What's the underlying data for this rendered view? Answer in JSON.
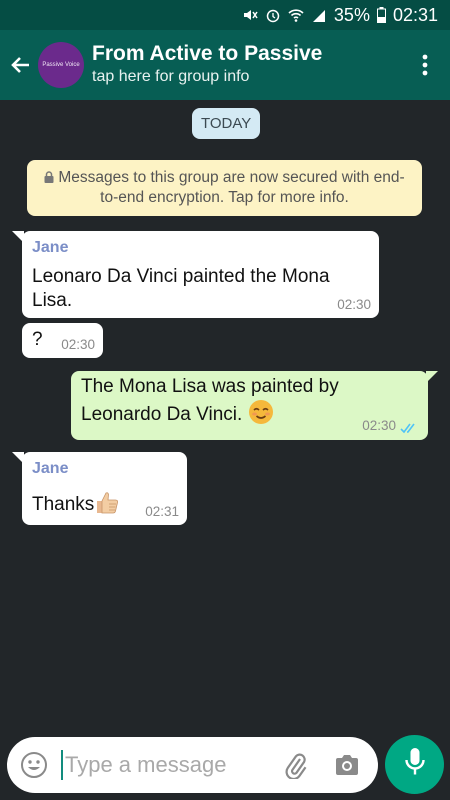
{
  "status_bar": {
    "battery": "35%",
    "time": "02:31"
  },
  "header": {
    "avatar_text": "Passive Voice",
    "title": "From Active to Passive",
    "subtitle": "tap here for group info"
  },
  "date_label": "TODAY",
  "encryption_notice": "Messages to this group are now secured with end-to-end encryption. Tap for more info.",
  "messages": [
    {
      "direction": "incoming",
      "sender": "Jane",
      "text": "Leonaro Da Vinci painted the Mona Lisa.",
      "time": "02:30"
    },
    {
      "direction": "incoming",
      "text": "?",
      "time": "02:30"
    },
    {
      "direction": "outgoing",
      "text": "The Mona Lisa was painted by Leonardo Da Vinci.",
      "emoji": "smiling-face-icon",
      "time": "02:30",
      "status": "read"
    },
    {
      "direction": "incoming",
      "sender": "Jane",
      "text": "Thanks",
      "emoji": "thumbs-up-icon",
      "time": "02:31"
    }
  ],
  "composer": {
    "placeholder": "Type a message"
  },
  "colors": {
    "header": "#075e54",
    "status_bar": "#054d44",
    "chat_background": "#222629",
    "incoming_bubble": "#ffffff",
    "outgoing_bubble": "#dcf8c6",
    "sender_name": "#7b8ec7",
    "read_ticks": "#4fc3f7",
    "mic_button": "#00a884"
  }
}
